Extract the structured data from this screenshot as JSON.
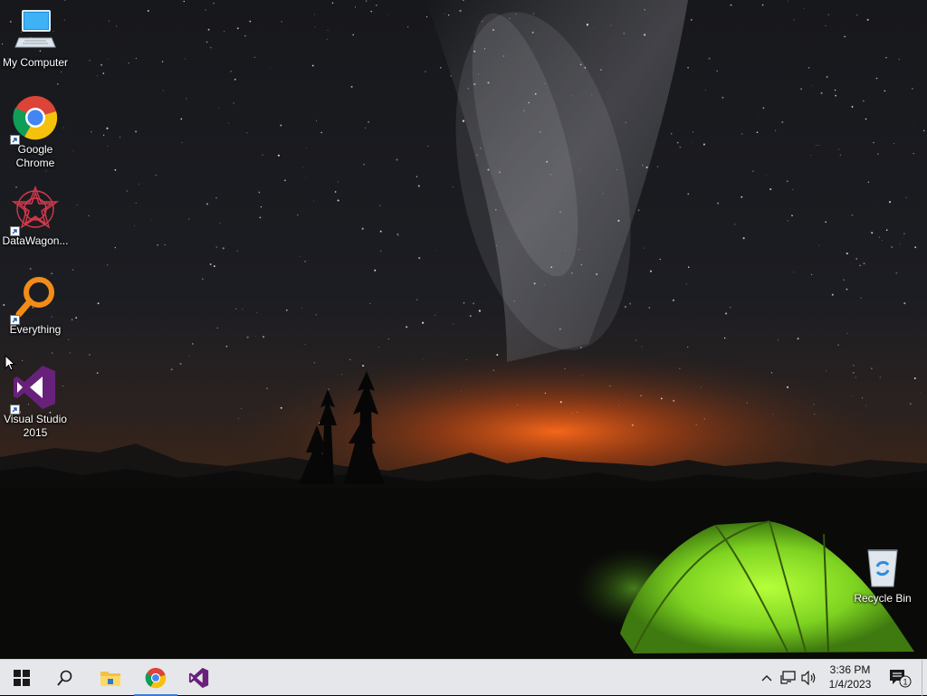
{
  "desktop": {
    "icons": [
      {
        "label": "My Computer",
        "icon": "computer-icon"
      },
      {
        "label": "Google\nChrome",
        "icon": "chrome-icon"
      },
      {
        "label": "DataWagon...",
        "icon": "datawagon-icon"
      },
      {
        "label": "Everything",
        "icon": "everything-search-icon"
      },
      {
        "label": "Visual Studio\n2015",
        "icon": "visual-studio-icon"
      },
      {
        "label": "Recycle Bin",
        "icon": "recycle-bin-icon"
      }
    ],
    "wallpaper": "night-sky-milky-way-green-tent"
  },
  "taskbar": {
    "pinned": [
      {
        "icon": "windows-start-icon",
        "active": false
      },
      {
        "icon": "search-icon",
        "active": false
      },
      {
        "icon": "file-explorer-icon",
        "active": false
      },
      {
        "icon": "chrome-icon",
        "active": true
      },
      {
        "icon": "visual-studio-icon",
        "active": false
      }
    ],
    "tray": {
      "icons": [
        "chevron-up-icon",
        "network-icon",
        "volume-icon"
      ],
      "time": "3:36 PM",
      "date": "1/4/2023",
      "notification_icon": "notification-center-icon",
      "notification_count": "1"
    }
  },
  "colors": {
    "taskbar_bg": "#e6e7ea",
    "active_indicator": "#3a7bd5",
    "tent_green": "#7ed321",
    "horizon_orange": "#e8601c"
  }
}
